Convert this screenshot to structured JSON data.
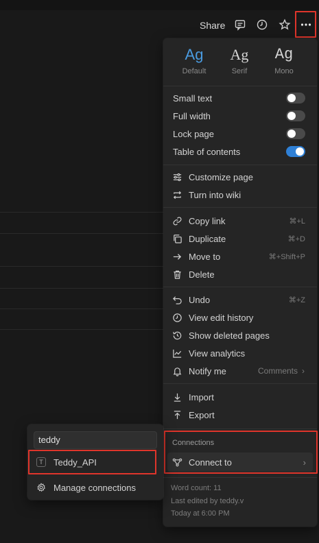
{
  "topbar": {
    "share_label": "Share",
    "icons": [
      "comment-icon",
      "clock-icon",
      "star-icon",
      "more-icon"
    ]
  },
  "menu": {
    "fonts": [
      {
        "glyph": "Ag",
        "label": "Default",
        "active": true
      },
      {
        "glyph": "Ag",
        "label": "Serif",
        "active": false
      },
      {
        "glyph": "Ag",
        "label": "Mono",
        "active": false
      }
    ],
    "toggles": [
      {
        "label": "Small text",
        "on": false
      },
      {
        "label": "Full width",
        "on": false
      },
      {
        "label": "Lock page",
        "on": false
      },
      {
        "label": "Table of contents",
        "on": true
      }
    ],
    "page_actions": [
      {
        "label": "Customize page",
        "icon": "sliders-icon"
      },
      {
        "label": "Turn into wiki",
        "icon": "convert-icon"
      }
    ],
    "edit_actions": [
      {
        "label": "Copy link",
        "icon": "link-icon",
        "shortcut": "⌘+L"
      },
      {
        "label": "Duplicate",
        "icon": "duplicate-icon",
        "shortcut": "⌘+D"
      },
      {
        "label": "Move to",
        "icon": "arrow-right-icon",
        "shortcut": "⌘+Shift+P"
      },
      {
        "label": "Delete",
        "icon": "trash-icon",
        "shortcut": ""
      }
    ],
    "history_actions": [
      {
        "label": "Undo",
        "icon": "undo-icon",
        "shortcut": "⌘+Z"
      },
      {
        "label": "View edit history",
        "icon": "history-icon",
        "shortcut": ""
      },
      {
        "label": "Show deleted pages",
        "icon": "restore-icon",
        "shortcut": ""
      },
      {
        "label": "View analytics",
        "icon": "chart-icon",
        "shortcut": ""
      },
      {
        "label": "Notify me",
        "icon": "bell-icon",
        "shortcut": "Comments"
      }
    ],
    "io_actions": [
      {
        "label": "Import",
        "icon": "import-icon"
      },
      {
        "label": "Export",
        "icon": "export-icon"
      }
    ],
    "connections_label": "Connections",
    "connect_label": "Connect to",
    "word_count": "Word count: 11",
    "last_edited": "Last edited by teddy.v",
    "edited_time": "Today at 6:00 PM"
  },
  "submenu": {
    "search_value": "teddy",
    "result_icon_letter": "T",
    "result_label": "Teddy_API",
    "manage_label": "Manage connections"
  }
}
